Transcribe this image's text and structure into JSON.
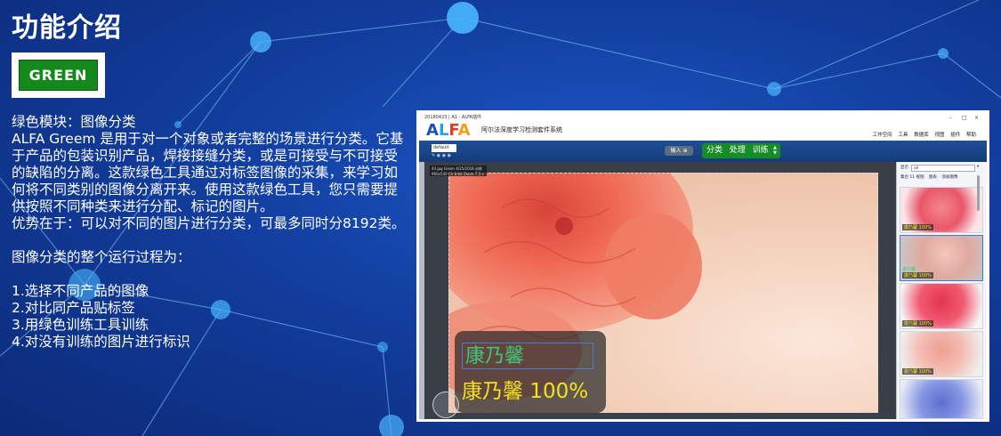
{
  "page_title": "功能介绍",
  "badge_label": "GREEN",
  "description": {
    "lines": [
      "绿色模块：图像分类",
      "ALFA Greem 是用于对一个对象或者完整的场景进行分类。它基于产品的包装识别产品，焊接接缝分类，或是可接受与不可接受的缺陷的分离。这款绿色工具通过对标签图像的采集，来学习如何将不同类别的图像分离开来。使用这款绿色工具，您只需要提供按照不同种类来进行分配、标记的图片。",
      "优势在于：可以对不同的图片进行分类，可最多同时分8192类。"
    ],
    "process_title": "图像分类的整个运行过程为：",
    "steps": [
      "1.选择不同产品的图像",
      "2.对比同产品贴标签",
      "3.用绿色训练工具训练",
      "4.对没有训练的图片进行标识"
    ]
  },
  "window": {
    "titlebar_text": "20180423 | A1 - ALFA插件",
    "controls": [
      "–",
      "□",
      "×"
    ],
    "logo": {
      "a1": "A",
      "l": "L",
      "f": "F",
      "a2": "A"
    },
    "app_name": "阿尔法深度学习检测套件系统",
    "menu": [
      "工作空间",
      "工具",
      "数据库",
      "视图",
      "插件",
      "帮助"
    ],
    "dataset_value": "default",
    "import_label": "输入",
    "modes": [
      "分类",
      "处理",
      "训练"
    ],
    "image_info": "44.jpg  Green  4/25/2018  训练",
    "image_info2": "960x540 Ch 8-bit  Zoom 7.5 x",
    "label_edit_value": "康乃馨",
    "label_result": "康乃馨 100%",
    "panel": {
      "search_label": "显示",
      "search_value": "all",
      "tabs": [
        "集合 11 视图",
        "图表",
        "添加图像"
      ],
      "thumbs": [
        {
          "caption": "康乃馨 100%",
          "caption2": ""
        },
        {
          "caption": "康乃馨 100%",
          "caption2": "康乃馨"
        },
        {
          "caption": "康乃馨 100%",
          "caption2": ""
        },
        {
          "caption": "康乃馨 100%",
          "caption2": ""
        },
        {
          "caption": "",
          "caption2": ""
        }
      ]
    }
  },
  "colors": {
    "badge_green": "#138a1b",
    "mode_green": "#158d25",
    "result_yellow": "#f2e21e",
    "label_green": "#45c37a"
  }
}
